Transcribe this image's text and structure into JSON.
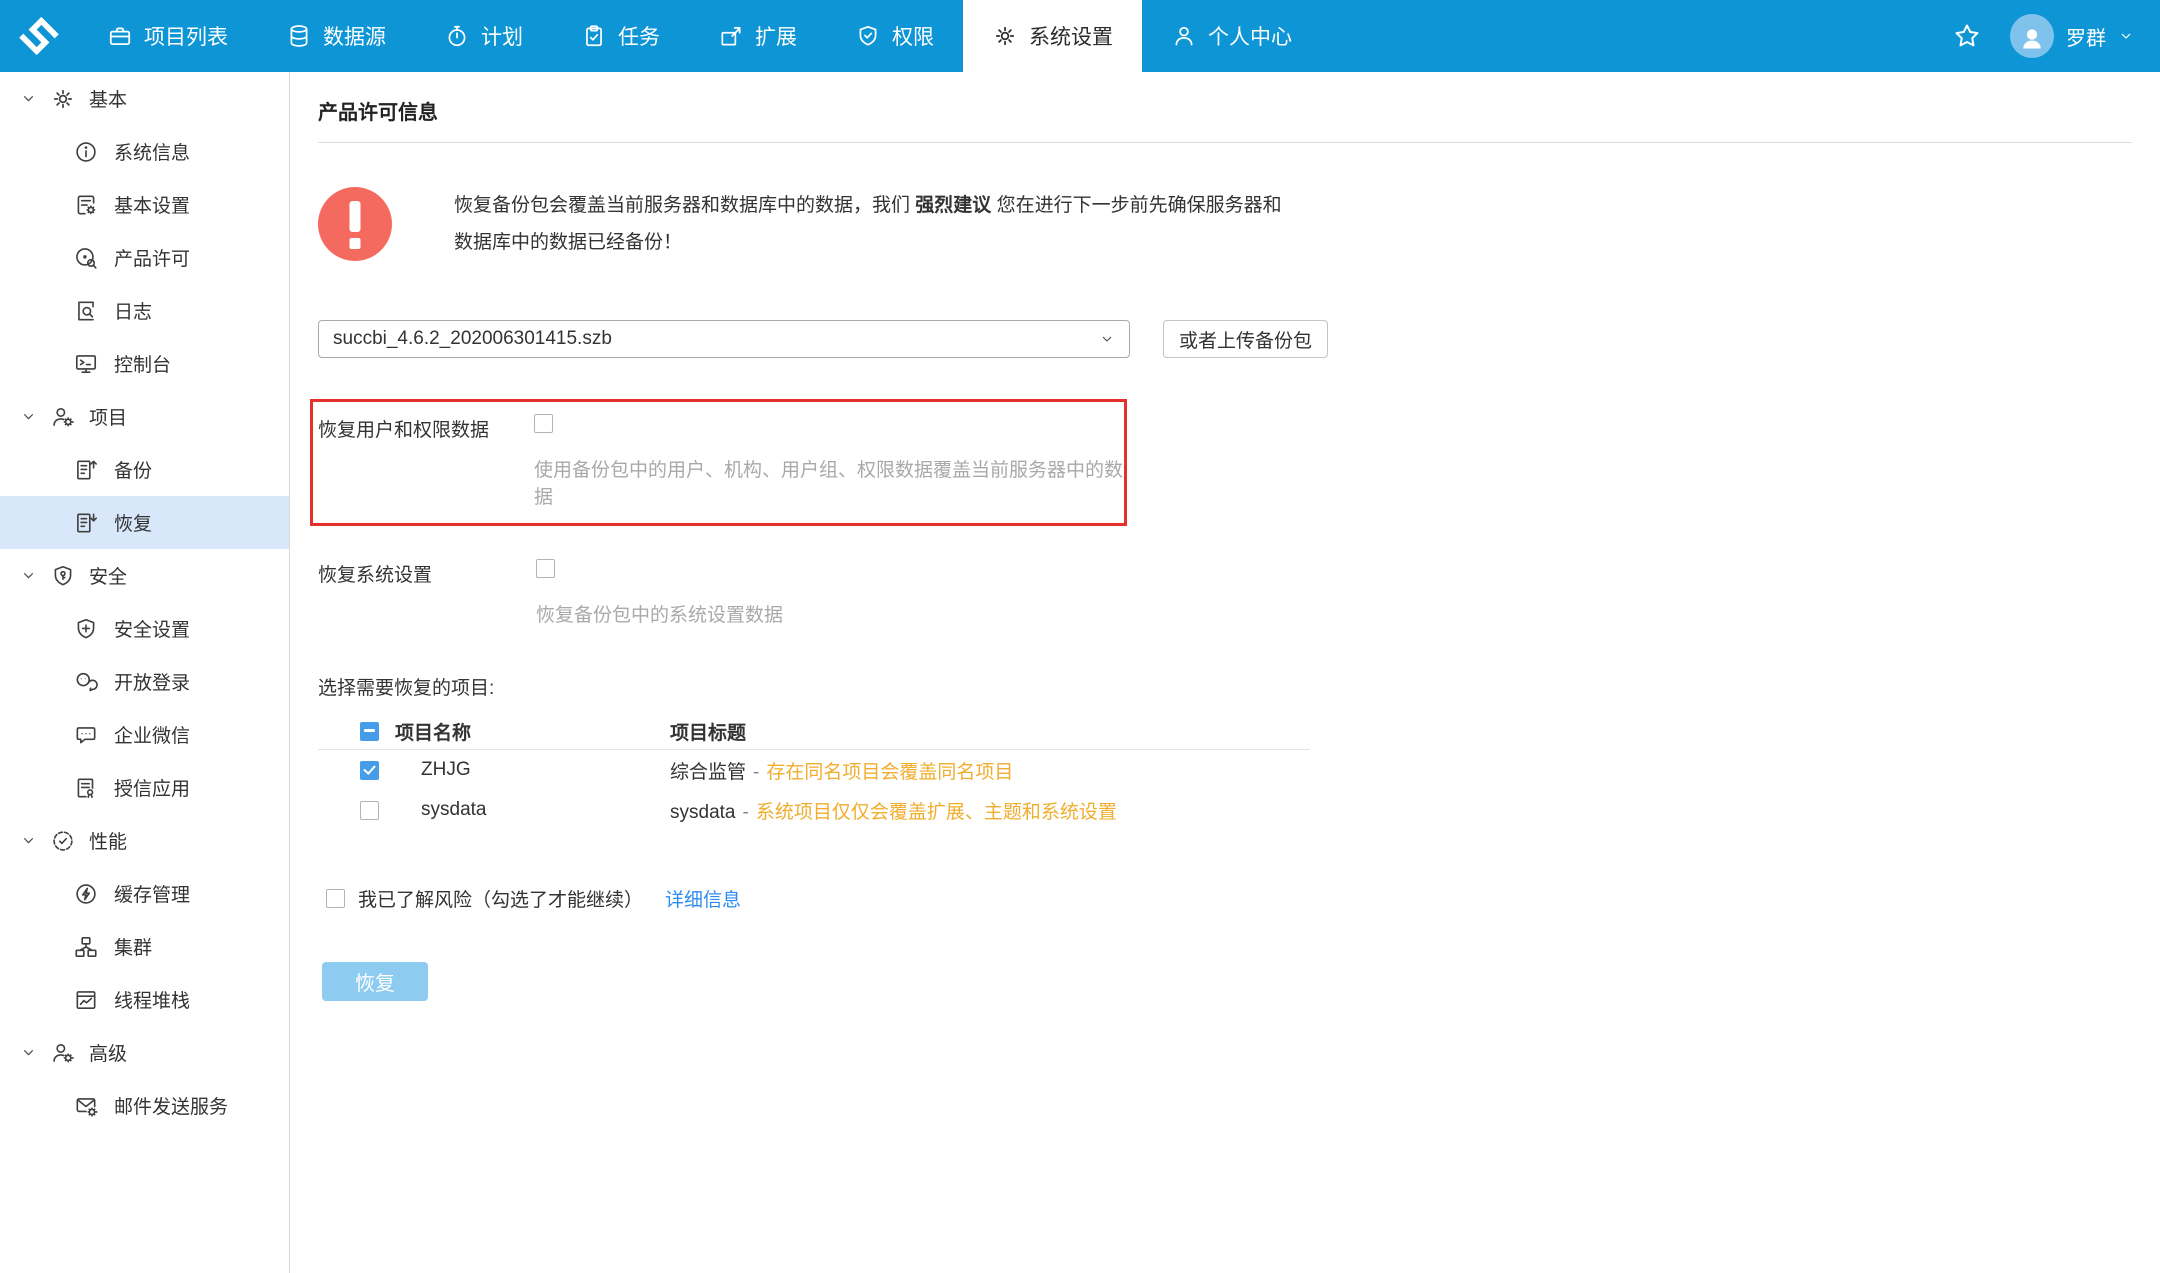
{
  "colors": {
    "nav_blue": "#0d95d6",
    "active_item_bg": "#d8e8fa",
    "checkbox_blue": "#459de9",
    "warning_red": "#f56a5f",
    "highlight_red": "#e5312b",
    "note_orange": "#f0ad2e",
    "link_blue": "#2d8cf0",
    "disabled_button_blue": "#8ecbf0",
    "avatar_blue": "#7fc3ec"
  },
  "nav": {
    "logo_icon": "succbi-logo",
    "items": [
      {
        "label": "项目列表",
        "icon": "briefcase-icon",
        "active": false
      },
      {
        "label": "数据源",
        "icon": "database-icon",
        "active": false
      },
      {
        "label": "计划",
        "icon": "stopwatch-icon",
        "active": false
      },
      {
        "label": "任务",
        "icon": "clipboard-icon",
        "active": false
      },
      {
        "label": "扩展",
        "icon": "package-icon",
        "active": false
      },
      {
        "label": "权限",
        "icon": "shield-icon",
        "active": false
      },
      {
        "label": "系统设置",
        "icon": "gear-icon",
        "active": true
      },
      {
        "label": "个人中心",
        "icon": "user-icon",
        "active": false
      }
    ],
    "star_icon": "star-icon",
    "user": {
      "name": "罗群",
      "avatar_icon": "user-solid-icon",
      "chevron_icon": "chevron-down-icon"
    }
  },
  "sidebar": {
    "items": [
      {
        "type": "group",
        "icon": "gear-icon",
        "label": "基本",
        "active": false
      },
      {
        "type": "item",
        "icon": "info-icon",
        "label": "系统信息",
        "active": false
      },
      {
        "type": "item",
        "icon": "doc-gear-icon",
        "label": "基本设置",
        "active": false
      },
      {
        "type": "item",
        "icon": "license-icon",
        "label": "产品许可",
        "active": false
      },
      {
        "type": "item",
        "icon": "log-icon",
        "label": "日志",
        "active": false
      },
      {
        "type": "item",
        "icon": "console-icon",
        "label": "控制台",
        "active": false
      },
      {
        "type": "group",
        "icon": "user-gear-icon",
        "label": "项目",
        "active": false
      },
      {
        "type": "item",
        "icon": "doc-up-icon",
        "label": "备份",
        "active": false
      },
      {
        "type": "item",
        "icon": "doc-down-icon",
        "label": "恢复",
        "active": true
      },
      {
        "type": "group",
        "icon": "shield-key-icon",
        "label": "安全",
        "active": false
      },
      {
        "type": "item",
        "icon": "shield-plus-icon",
        "label": "安全设置",
        "active": false
      },
      {
        "type": "item",
        "icon": "wechat-icon",
        "label": "开放登录",
        "active": false
      },
      {
        "type": "item",
        "icon": "chat-icon",
        "label": "企业微信",
        "active": false
      },
      {
        "type": "item",
        "icon": "doc-seal-icon",
        "label": "授信应用",
        "active": false
      },
      {
        "type": "group",
        "icon": "gauge-icon",
        "label": "性能",
        "active": false
      },
      {
        "type": "item",
        "icon": "cache-icon",
        "label": "缓存管理",
        "active": false
      },
      {
        "type": "item",
        "icon": "cluster-icon",
        "label": "集群",
        "active": false
      },
      {
        "type": "item",
        "icon": "thread-icon",
        "label": "线程堆栈",
        "active": false
      },
      {
        "type": "group",
        "icon": "user-gear-icon",
        "label": "高级",
        "active": false
      },
      {
        "type": "item",
        "icon": "mail-gear-icon",
        "label": "邮件发送服务",
        "active": false
      }
    ]
  },
  "main": {
    "title": "产品许可信息",
    "warning": {
      "icon": "exclamation-circle-icon",
      "pre": "恢复备份包会覆盖当前服务器和数据库中的数据，我们 ",
      "bold": "强烈建议",
      "post": " 您在进行下一步前先确保服务器和数据库中的数据已经备份！"
    },
    "package_select": {
      "value": "succbi_4.6.2_202006301415.szb",
      "chevron_icon": "chevron-down-icon"
    },
    "upload_button_label": "或者上传备份包",
    "options": [
      {
        "label": "恢复用户和权限数据",
        "checked": false,
        "desc": "使用备份包中的用户、机构、用户组、权限数据覆盖当前服务器中的数据",
        "highlighted": true
      },
      {
        "label": "恢复系统设置",
        "checked": false,
        "desc": "恢复备份包中的系统设置数据",
        "highlighted": false
      }
    ],
    "projects": {
      "label": "选择需要恢复的项目:",
      "select_all_state": "indeterminate",
      "columns": [
        "项目名称",
        "项目标题"
      ],
      "rows": [
        {
          "checked": true,
          "name": "ZHJG",
          "title": "综合监管",
          "sep": "-",
          "note": "存在同名项目会覆盖同名项目"
        },
        {
          "checked": false,
          "name": "sysdata",
          "title": "sysdata",
          "sep": "-",
          "note": "系统项目仅仅会覆盖扩展、主题和系统设置"
        }
      ]
    },
    "risk": {
      "checked": false,
      "label": "我已了解风险（勾选了才能继续）",
      "link": "详细信息"
    },
    "submit": {
      "label": "恢复",
      "disabled": true
    }
  }
}
